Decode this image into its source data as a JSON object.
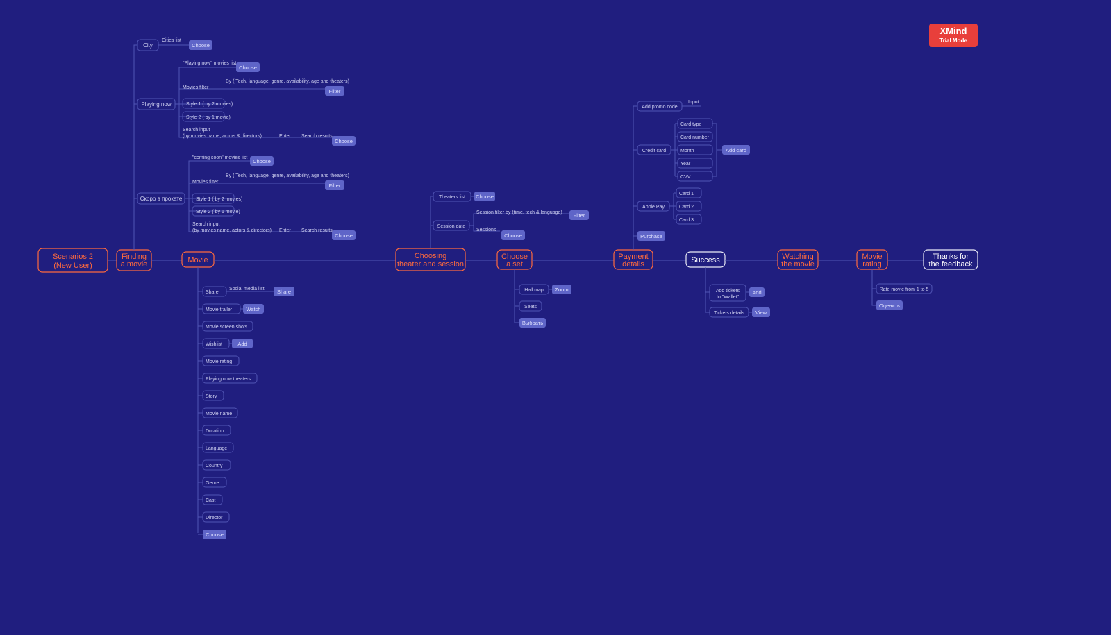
{
  "watermark": {
    "title": "XMind",
    "subtitle": "Trial Mode"
  },
  "root": {
    "line1": "Scenarios 2",
    "line2": "(New User)"
  },
  "main": {
    "finding": {
      "l1": "Finding",
      "l2": "a movie"
    },
    "movie": "Movie",
    "choosing": {
      "l1": "Choosing",
      "l2": "theater and session"
    },
    "chooseSet": {
      "l1": "Choose",
      "l2": "a set"
    },
    "payment": {
      "l1": "Payment",
      "l2": "details"
    },
    "success": "Success",
    "watching": {
      "l1": "Watching",
      "l2": "the movie"
    },
    "rating": {
      "l1": "Movie",
      "l2": "rating"
    },
    "thanks": {
      "l1": "Thanks for",
      "l2": "the feedback"
    }
  },
  "finding": {
    "city": "City",
    "citiesList": "Cities list",
    "playingNow": "Playing now",
    "comingSoon": "Скоро в прокате",
    "pn": {
      "list": "\"Playing now\" movies list",
      "filter": "Movies filter",
      "filterDesc": "By ( Tech, language, genre, availability, age and theaters)",
      "style1": "Style 1 ( by 2 movies)",
      "style2": "Style 2 ( by 1 movie)",
      "searchL1": "Search input",
      "searchL2": "(by movies name, actors & directors)",
      "enter": "Enter",
      "results": "Search results"
    },
    "cs": {
      "list": "\"coming soon\" movies list",
      "filter": "Movies filter",
      "filterDesc": "By ( Tech, language, genre, availability, age and theaters)",
      "style1": "Style 1 ( by 2 movies)",
      "style2": "Style 2 ( by 1 movie)",
      "searchL1": "Search input",
      "searchL2": "(by movies name, actors & directors)",
      "enter": "Enter",
      "results": "Search results"
    }
  },
  "movie": {
    "share": "Share",
    "socialMedia": "Social media list",
    "trailer": "Movie trailer",
    "screenshots": "Movie screen shots",
    "wishlist": "Wishlist",
    "ratingItem": "Movie rating",
    "playingTheaters": "Playing now theaters",
    "story": "Story",
    "movieName": "Movie name",
    "duration": "Duration",
    "language": "Language",
    "country": "Country",
    "genre": "Genre",
    "cast": "Cast",
    "director": "Director"
  },
  "choosing": {
    "theatersList": "Theaters list",
    "sessionDate": "Session date",
    "sessionFilter": "Session filter by (time, tech & language)",
    "sessions": "Sessions"
  },
  "chooseSet": {
    "hallMap": "Hall map",
    "seats": "Seats",
    "vybrat": "Выбрать"
  },
  "payment": {
    "addPromo": "Add promo code",
    "input": "Input",
    "creditCard": "Credit card",
    "cardType": "Card type",
    "cardNumber": "Card number",
    "month": "Month",
    "year": "Year",
    "cvv": "CVV",
    "applePay": "Apple Pay",
    "card1": "Card 1",
    "card2": "Card 2",
    "card3": "Card 3",
    "purchase": "Purchase"
  },
  "success": {
    "addWallet": {
      "l1": "Add tickets",
      "l2": "to \"Wallet\""
    },
    "ticketDetails": "Tickets details"
  },
  "rating": {
    "rateMovie": "Rate movie from 1 to 5",
    "ocenit": "Оценить"
  },
  "btn": {
    "choose": "Choose",
    "filter": "Filter",
    "share": "Share",
    "watch": "Watch",
    "add": "Add",
    "zoom": "Zoom",
    "view": "View",
    "addCard": "Add card"
  }
}
